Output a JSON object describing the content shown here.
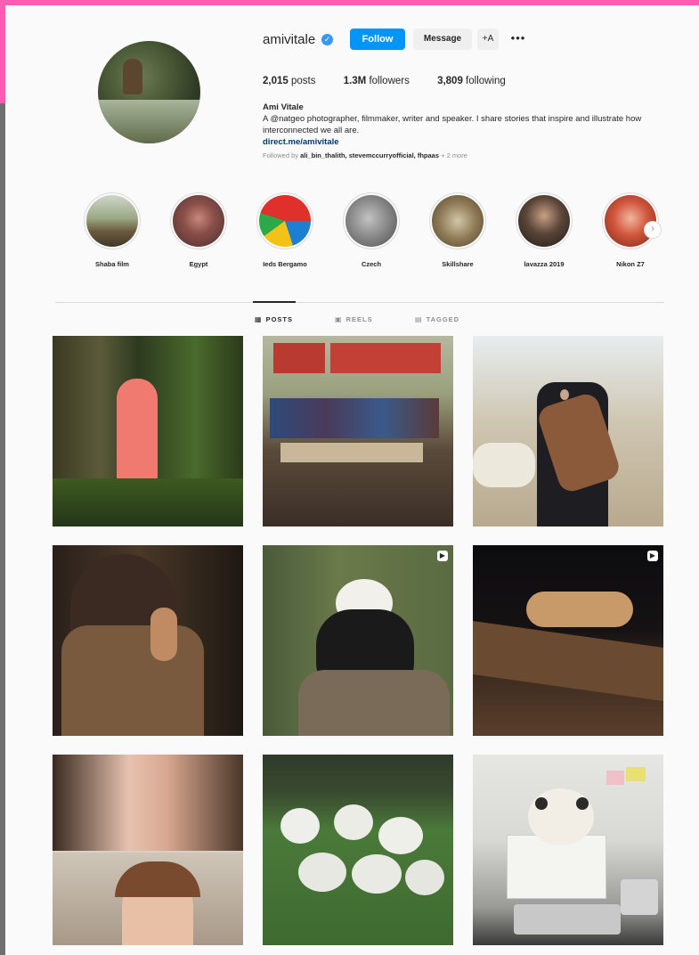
{
  "profile": {
    "username": "amivitale",
    "verified_icon": "verified-badge-icon",
    "follow_label": "Follow",
    "message_label": "Message",
    "suggest_label": "+A",
    "more_label": "•••",
    "stats": {
      "posts_count": "2,015",
      "posts_label": "posts",
      "followers_count": "1.3M",
      "followers_label": "followers",
      "following_count": "3,809",
      "following_label": "following"
    },
    "full_name": "Ami Vitale",
    "bio": "A @natgeo photographer, filmmaker, writer and speaker. I share stories that inspire and illustrate how interconnected we all are.",
    "link": "direct.me/amivitale",
    "followed_by_prefix": "Followed by",
    "followed_by_names": "ali_bin_thalith, stevemccurryofficial, fhpaas",
    "followed_by_suffix": "+ 2 more"
  },
  "highlights": [
    {
      "label": "Shaba film"
    },
    {
      "label": "Egypt"
    },
    {
      "label": "Ieds Bergamo"
    },
    {
      "label": "Czech"
    },
    {
      "label": "Skillshare"
    },
    {
      "label": "lavazza 2019"
    },
    {
      "label": "Nikon Z7"
    }
  ],
  "tabs": {
    "posts": "POSTS",
    "reels": "REELS",
    "tagged": "TAGGED"
  },
  "colors": {
    "accent": "#0095f6",
    "link": "#00376b",
    "frame_pink": "#ff5db1"
  }
}
